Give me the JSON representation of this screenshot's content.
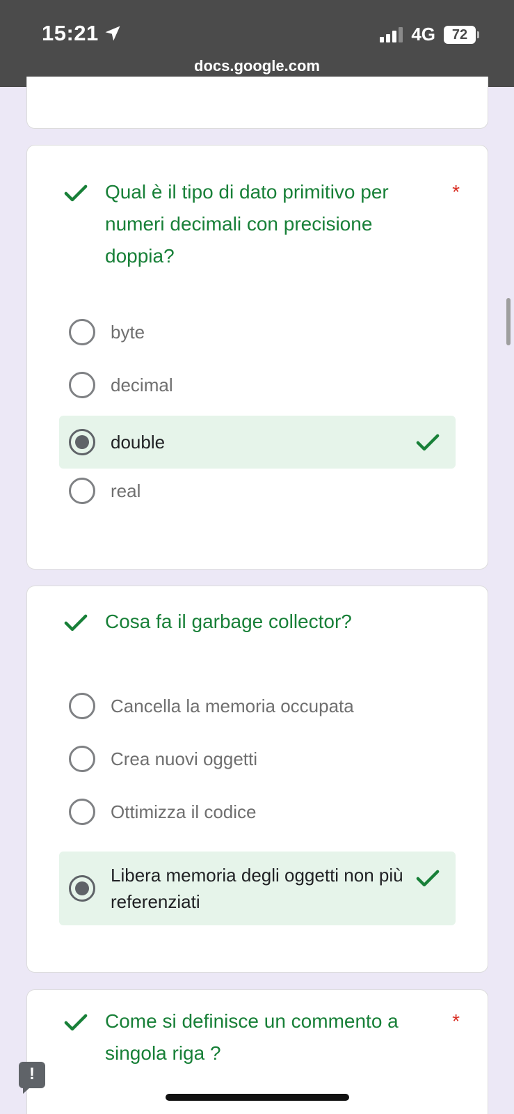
{
  "status_bar": {
    "time": "15:21",
    "network": "4G",
    "battery": "72",
    "url": "docs.google.com"
  },
  "questions": [
    {
      "text": "Qual è il tipo di dato primitivo per numeri decimali con precisione doppia?",
      "required_mark": "*",
      "options": [
        "byte",
        "decimal",
        "double",
        "real"
      ],
      "selected_option": "double"
    },
    {
      "text": "Cosa fa il garbage collector?",
      "options": [
        "Cancella la memoria occupata",
        "Crea nuovi oggetti",
        "Ottimizza il codice",
        "Libera memoria degli oggetti non più referenziati"
      ],
      "selected_option": "Libera memoria degli oggetti non più referenziati"
    },
    {
      "text": "Come si definisce un commento a singola riga ?",
      "required_mark": "*"
    }
  ],
  "feedback_icon": "!",
  "colors": {
    "correct_green": "#188038",
    "selected_bg": "#e6f4ea",
    "required_red": "#d93025",
    "page_bg": "#ece8f6"
  }
}
